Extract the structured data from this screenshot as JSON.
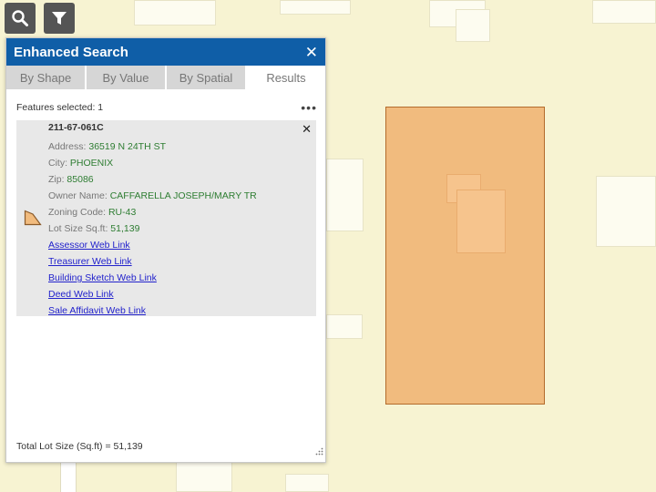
{
  "toolbar": {
    "search_icon": "search-icon",
    "filter_icon": "filter-icon"
  },
  "panel": {
    "title": "Enhanced Search",
    "close_glyph": "✕",
    "tabs": [
      {
        "label": "By Shape",
        "active": false
      },
      {
        "label": "By Value",
        "active": false
      },
      {
        "label": "By Spatial",
        "active": false
      },
      {
        "label": "Results",
        "active": true
      }
    ],
    "features_selected": "Features selected: 1",
    "more_glyph": "•••",
    "result": {
      "parcel_id": "211-67-061C",
      "close_glyph": "✕",
      "fields": [
        {
          "label": "Address: ",
          "value": "36519 N 24TH ST"
        },
        {
          "label": "City: ",
          "value": "PHOENIX"
        },
        {
          "label": "Zip: ",
          "value": "85086"
        },
        {
          "label": "Owner Name: ",
          "value": "CAFFARELLA JOSEPH/MARY TR"
        },
        {
          "label": "Zoning Code: ",
          "value": "RU-43"
        },
        {
          "label": "Lot Size Sq.ft: ",
          "value": "51,139"
        }
      ],
      "links": [
        "Assessor Web Link",
        "Treasurer Web Link",
        "Building Sketch Web Link",
        "Deed Web Link",
        "Sale Affidavit Web Link"
      ]
    },
    "total": "Total Lot Size (Sq.ft) = 51,139"
  },
  "colors": {
    "header": "#0f5ea7",
    "parcel_fill": "#f1bb7e",
    "parcel_outline": "#b36b2c",
    "value_green": "#2e7d32",
    "link_blue": "#2222cc"
  }
}
